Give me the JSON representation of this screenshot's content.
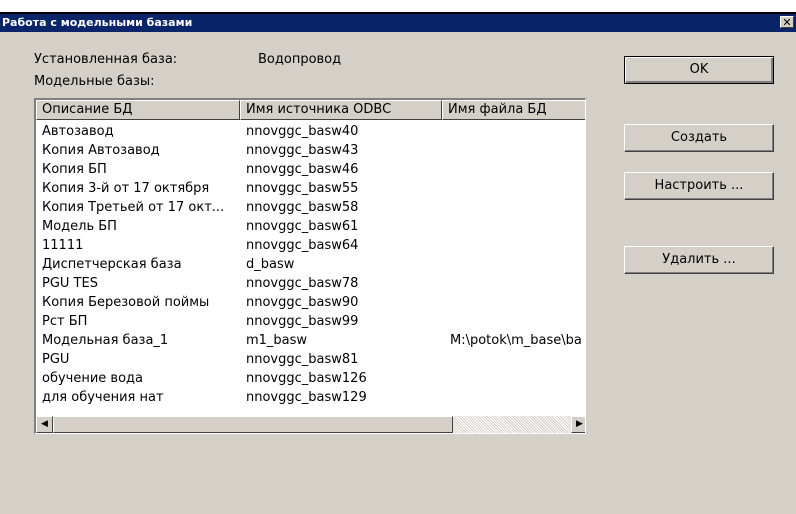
{
  "window": {
    "title": "Работа с модельными базами",
    "close_glyph": "✕"
  },
  "installed": {
    "label": "Установленная база:",
    "value": "Водопровод"
  },
  "models_label": "Модельные базы:",
  "table": {
    "columns": [
      "Описание БД",
      "Имя источника ODBC",
      "Имя файла БД"
    ],
    "rows": [
      [
        "Автозавод",
        "nnovggc_basw40",
        ""
      ],
      [
        "Копия Автозавод",
        "nnovggc_basw43",
        ""
      ],
      [
        "Копия БП",
        "nnovggc_basw46",
        ""
      ],
      [
        "Копия 3-й от 17 октября",
        "nnovggc_basw55",
        ""
      ],
      [
        "Копия Третьей от 17 окт...",
        "nnovggc_basw58",
        ""
      ],
      [
        "Модель БП",
        "nnovggc_basw61",
        ""
      ],
      [
        "11111",
        "nnovggc_basw64",
        ""
      ],
      [
        "Диспетчерская база",
        "d_basw",
        ""
      ],
      [
        "PGU TES",
        "nnovggc_basw78",
        ""
      ],
      [
        "Копия Березовой поймы",
        "nnovggc_basw90",
        ""
      ],
      [
        "Рст БП",
        "nnovggc_basw99",
        ""
      ],
      [
        "Модельная база_1",
        "m1_basw",
        "M:\\potok\\m_base\\ba"
      ],
      [
        "PGU",
        "nnovggc_basw81",
        ""
      ],
      [
        "обучение вода",
        "nnovggc_basw126",
        ""
      ],
      [
        "для обучения нат",
        "nnovggc_basw129",
        ""
      ]
    ]
  },
  "buttons": {
    "ok": "OK",
    "create": "Создать",
    "configure": "Настроить ...",
    "delete": "Удалить ..."
  },
  "icons": {
    "scroll_up": "scroll-up-arrow-icon",
    "scroll_down": "scroll-down-arrow-icon",
    "scroll_left": "scroll-left-arrow-icon",
    "scroll_right": "scroll-right-arrow-icon"
  },
  "colors": {
    "titlebar": "#0a246a",
    "dialog_bg": "#d4d0c8"
  }
}
